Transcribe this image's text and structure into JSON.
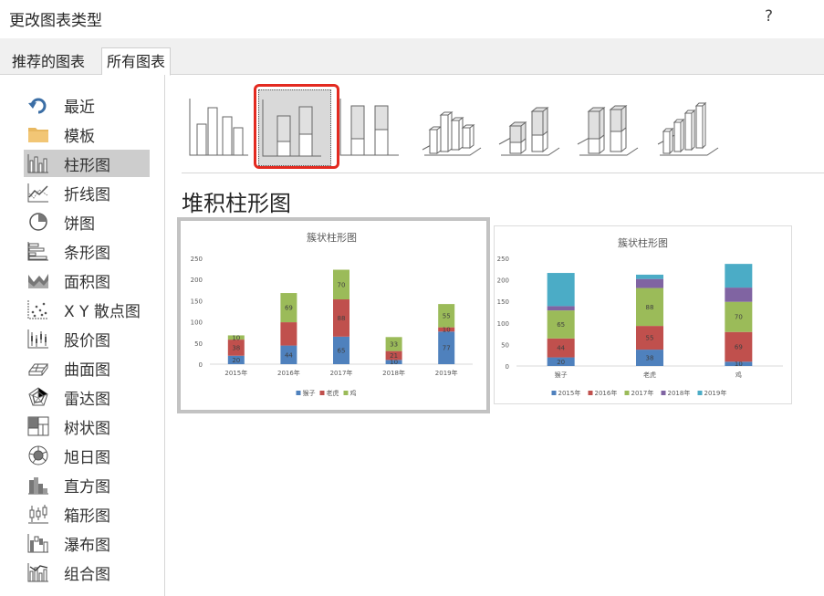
{
  "dialog": {
    "title": "更改图表类型",
    "help": "?"
  },
  "tabs": [
    {
      "label": "推荐的图表"
    },
    {
      "label": "所有图表"
    }
  ],
  "sidebar": {
    "items": [
      {
        "label": "最近",
        "icon": "recent-icon"
      },
      {
        "label": "模板",
        "icon": "folder-icon"
      },
      {
        "label": "柱形图",
        "icon": "column-chart-icon",
        "selected": true
      },
      {
        "label": "折线图",
        "icon": "line-chart-icon"
      },
      {
        "label": "饼图",
        "icon": "pie-chart-icon"
      },
      {
        "label": "条形图",
        "icon": "bar-chart-icon"
      },
      {
        "label": "面积图",
        "icon": "area-chart-icon"
      },
      {
        "label": "X Y 散点图",
        "icon": "scatter-chart-icon"
      },
      {
        "label": "股价图",
        "icon": "stock-chart-icon"
      },
      {
        "label": "曲面图",
        "icon": "surface-chart-icon"
      },
      {
        "label": "雷达图",
        "icon": "radar-chart-icon"
      },
      {
        "label": "树状图",
        "icon": "treemap-icon"
      },
      {
        "label": "旭日图",
        "icon": "sunburst-icon"
      },
      {
        "label": "直方图",
        "icon": "histogram-icon"
      },
      {
        "label": "箱形图",
        "icon": "box-whisker-icon"
      },
      {
        "label": "瀑布图",
        "icon": "waterfall-icon"
      },
      {
        "label": "组合图",
        "icon": "combo-chart-icon"
      }
    ]
  },
  "subtypes": [
    {
      "icon": "clustered-column-icon"
    },
    {
      "icon": "stacked-column-icon",
      "selected": true
    },
    {
      "icon": "100-stacked-column-icon"
    },
    {
      "icon": "3d-clustered-column-icon"
    },
    {
      "icon": "3d-stacked-column-icon"
    },
    {
      "icon": "3d-100-stacked-column-icon"
    },
    {
      "icon": "3d-column-icon"
    }
  ],
  "selected_type_title": "堆积柱形图",
  "colors": {
    "blue": "#4f81bd",
    "red": "#c0504d",
    "green": "#9bbb59",
    "purple": "#8064a2",
    "cyan": "#4bacc6",
    "accent_red": "#e32a20"
  },
  "chart_data": [
    {
      "type": "bar",
      "stacked": true,
      "title": "簇状柱形图",
      "categories": [
        "2015年",
        "2016年",
        "2017年",
        "2018年",
        "2019年"
      ],
      "ylim": [
        0,
        250
      ],
      "yticks": [
        "0",
        "50",
        "100",
        "150",
        "200",
        "250"
      ],
      "legend": "bottom",
      "series": [
        {
          "name": "猴子",
          "color": "#4f81bd",
          "values": [
            20,
            44,
            65,
            10,
            77
          ],
          "labels": [
            "20",
            "44",
            "65",
            "10",
            "77"
          ]
        },
        {
          "name": "老虎",
          "color": "#c0504d",
          "values": [
            38,
            55,
            88,
            21,
            10
          ],
          "labels": [
            "38",
            "",
            "88",
            "21",
            "10"
          ]
        },
        {
          "name": "鸡",
          "color": "#9bbb59",
          "values": [
            10,
            69,
            70,
            33,
            55
          ],
          "labels": [
            "10",
            "69",
            "70",
            "33",
            "55"
          ]
        }
      ]
    },
    {
      "type": "bar",
      "stacked": true,
      "title": "簇状柱形图",
      "categories": [
        "猴子",
        "老虎",
        "鸡"
      ],
      "ylim": [
        0,
        250
      ],
      "yticks": [
        "0",
        "50",
        "100",
        "150",
        "200",
        "250"
      ],
      "legend": "bottom",
      "series": [
        {
          "name": "2015年",
          "color": "#4f81bd",
          "values": [
            20,
            38,
            10
          ],
          "labels": [
            "20",
            "38",
            "10"
          ]
        },
        {
          "name": "2016年",
          "color": "#c0504d",
          "values": [
            44,
            55,
            69
          ],
          "labels": [
            "44",
            "55",
            "69"
          ]
        },
        {
          "name": "2017年",
          "color": "#9bbb59",
          "values": [
            65,
            88,
            70
          ],
          "labels": [
            "65",
            "88",
            "70"
          ]
        },
        {
          "name": "2018年",
          "color": "#8064a2",
          "values": [
            10,
            21,
            33
          ],
          "labels": [
            "",
            "",
            ""
          ]
        },
        {
          "name": "2019年",
          "color": "#4bacc6",
          "values": [
            77,
            10,
            55
          ],
          "labels": [
            "",
            "",
            ""
          ]
        }
      ]
    }
  ]
}
